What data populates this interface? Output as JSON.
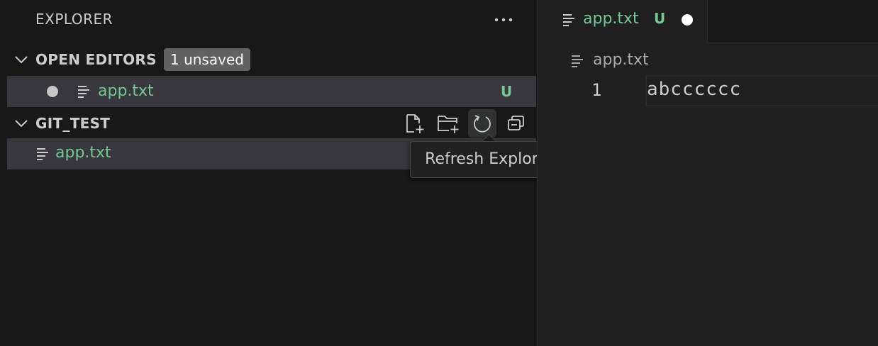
{
  "explorer": {
    "title": "EXPLORER",
    "more_actions_icon": "ellipsis-icon"
  },
  "open_editors": {
    "label": "OPEN EDITORS",
    "badge": "1 unsaved",
    "items": [
      {
        "name": "app.txt",
        "status": "U",
        "dirty": true
      }
    ]
  },
  "folder": {
    "label": "GIT_TEST",
    "actions": [
      "new-file-icon",
      "new-folder-icon",
      "refresh-icon",
      "collapse-all-icon"
    ],
    "files": [
      {
        "name": "app.txt"
      }
    ]
  },
  "tooltip": {
    "text": "Refresh Explorer"
  },
  "editor": {
    "tab": {
      "name": "app.txt",
      "status": "U",
      "dirty": true
    },
    "breadcrumb": "app.txt",
    "lines": [
      {
        "number": "1",
        "text": "abcccccc"
      }
    ]
  },
  "colors": {
    "untracked": "#73c991",
    "background": "#181818",
    "editor_bg": "#1f1f1f",
    "selection": "#37373d"
  }
}
